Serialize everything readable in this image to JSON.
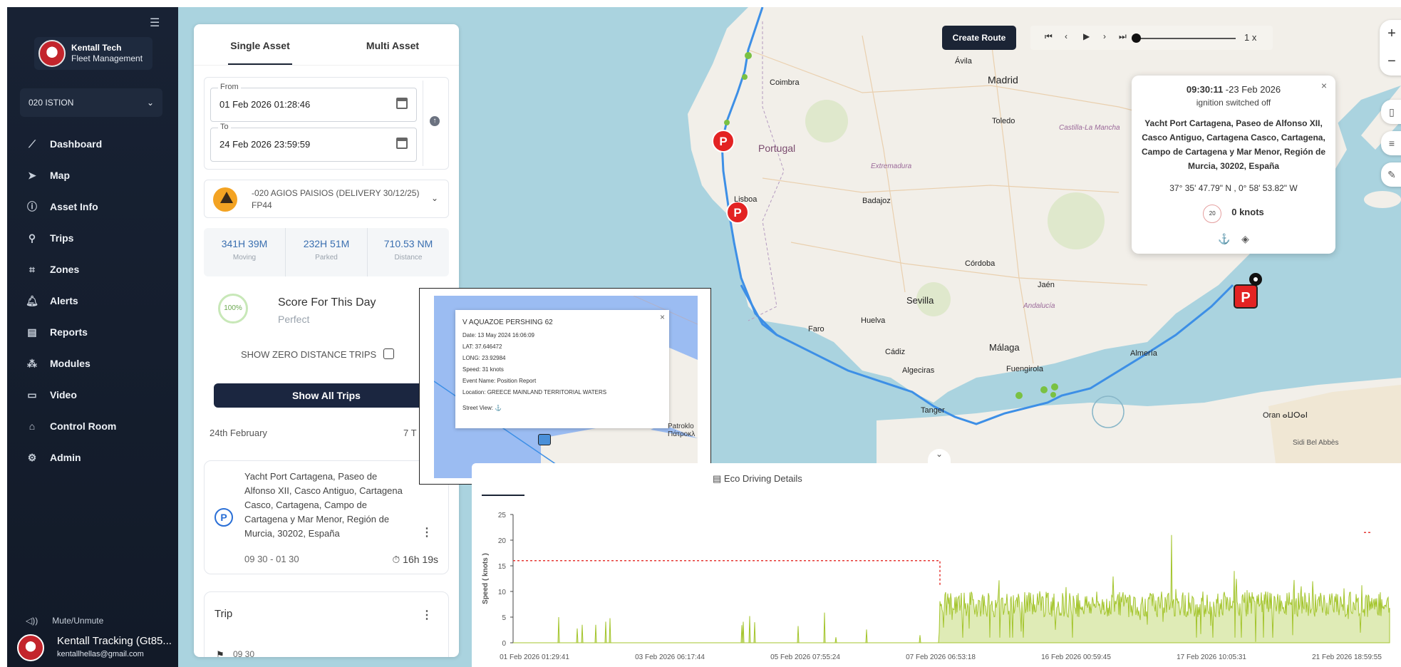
{
  "sidebar": {
    "brand_name": "Kentall Tech",
    "brand_sub": "Fleet Management",
    "org": "020 ISTION",
    "nav": [
      {
        "label": "Dashboard",
        "icon": "chart-line-icon",
        "glyph": "⟋"
      },
      {
        "label": "Map",
        "icon": "navigation-arrow-icon",
        "glyph": "➤"
      },
      {
        "label": "Asset Info",
        "icon": "info-circle-icon",
        "glyph": "ⓘ"
      },
      {
        "label": "Trips",
        "icon": "route-icon",
        "glyph": "⚲"
      },
      {
        "label": "Zones",
        "icon": "zone-icon",
        "glyph": "⌗"
      },
      {
        "label": "Alerts",
        "icon": "bell-icon",
        "glyph": "🔔︎"
      },
      {
        "label": "Reports",
        "icon": "document-icon",
        "glyph": "▤"
      },
      {
        "label": "Modules",
        "icon": "modules-icon",
        "glyph": "⁂"
      },
      {
        "label": "Video",
        "icon": "video-icon",
        "glyph": "▭"
      },
      {
        "label": "Control Room",
        "icon": "control-room-icon",
        "glyph": "⌂"
      },
      {
        "label": "Admin",
        "icon": "gear-icon",
        "glyph": "⚙"
      }
    ],
    "mute_label": "Mute/Unmute",
    "user_name": "Kentall Tracking (Gt85...",
    "user_email": "kentallhellas@gmail.com"
  },
  "panel": {
    "tabs": [
      "Single Asset",
      "Multi Asset"
    ],
    "from_label": "From",
    "from_value": "01 Feb 2026 01:28:46",
    "to_label": "To",
    "to_value": "24 Feb 2026 23:59:59",
    "asset_name": "-020 AGIOS PAISIOS (DELIVERY 30/12/25) FP44",
    "stats": [
      {
        "value": "341H 39M",
        "label": "Moving"
      },
      {
        "value": "232H 51M",
        "label": "Parked"
      },
      {
        "value": "710.53 NM",
        "label": "Distance"
      }
    ],
    "score_pct": "100%",
    "score_title": "Score For This Day",
    "score_sub": "Perfect",
    "zero_trips_label": "SHOW ZERO DISTANCE TRIPS",
    "show_all_label": "Show All Trips",
    "day_header": "24th February",
    "day_count": "7 T",
    "trip_address": "Yacht Port Cartagena, Paseo de Alfonso XII, Casco Antiguo, Cartagena Casco, Cartagena, Campo de Cartagena y Mar Menor, Región de Murcia, 30202, España",
    "trip_time": "09 30 - 01 30",
    "trip_duration": "⏱ 16h 19s",
    "trip2_title": "Trip",
    "trip2_time": "09 30"
  },
  "map": {
    "create_route": "Create Route",
    "speed_multiplier": "1 x",
    "labels": {
      "portugal": "Portugal",
      "lisboa": "Lisboa",
      "madrid": "Madrid",
      "sevilla": "Sevilla",
      "malaga": "Málaga",
      "cordoba": "Córdoba",
      "coimbra": "Coimbra",
      "toledo": "Toledo",
      "algeciras": "Algeciras",
      "tanger": "Tanger",
      "oran": "Oran ⴰⵡⵔⴰⵏ",
      "almeria": "Almería",
      "jaen": "Jaén",
      "badajoz": "Badajoz",
      "faro": "Faro",
      "huelva": "Huelva",
      "avila": "Ávila",
      "cadiz": "Cádiz",
      "fuengirola": "Fuengirola",
      "extremadura": "Extremadura",
      "andalucia": "Andalucía",
      "castilla": "Castilla-La Mancha",
      "sidi": "Sidi Bel Abbès"
    }
  },
  "info_popup": {
    "time": "09:30:11",
    "date": " -23 Feb 2026",
    "status": "ignition switched off",
    "address": "Yacht Port Cartagena, Paseo de Alfonso XII, Casco Antiguo, Cartagena Casco, Cartagena, Campo de Cartagena y Mar Menor, Región de Murcia, 30202, España",
    "coords": "37° 35' 47.79\" N , 0° 58' 53.82\" W",
    "speed_badge": "20",
    "speed": "0 knots"
  },
  "overlay": {
    "title": "V AQUAZOE PERSHING 62",
    "date": "Date: 13 May 2024 16:06:09",
    "lat": "LAT: 37.646472",
    "long": "LONG: 23.92984",
    "speed": "Speed: 31 knots",
    "event": "Event Name: Position Report",
    "location": "Location: GREECE MAINLAND TERRITORIAL WATERS",
    "street_view": "Street View:",
    "place": "Patroklo\nΠάτροκλ"
  },
  "chart_panel": {
    "tab_label": "Eco Driving Details"
  },
  "chart_data": {
    "type": "area",
    "ylabel": "Speed ( knots )",
    "ylim": [
      0,
      25
    ],
    "yticks": [
      0,
      5,
      10,
      15,
      20,
      25
    ],
    "xticks": [
      "01 Feb 2026 01:29:41",
      "03 Feb 2026 06:17:44",
      "05 Feb 2026 07:55:24",
      "07 Feb 2026 06:53:18",
      "16 Feb 2026 00:59:45",
      "17 Feb 2026 10:05:31",
      "21 Feb 2026 18:59:55"
    ],
    "speed_limit": {
      "value": 16,
      "color": "#e53935"
    },
    "color": "#a4c52d"
  }
}
